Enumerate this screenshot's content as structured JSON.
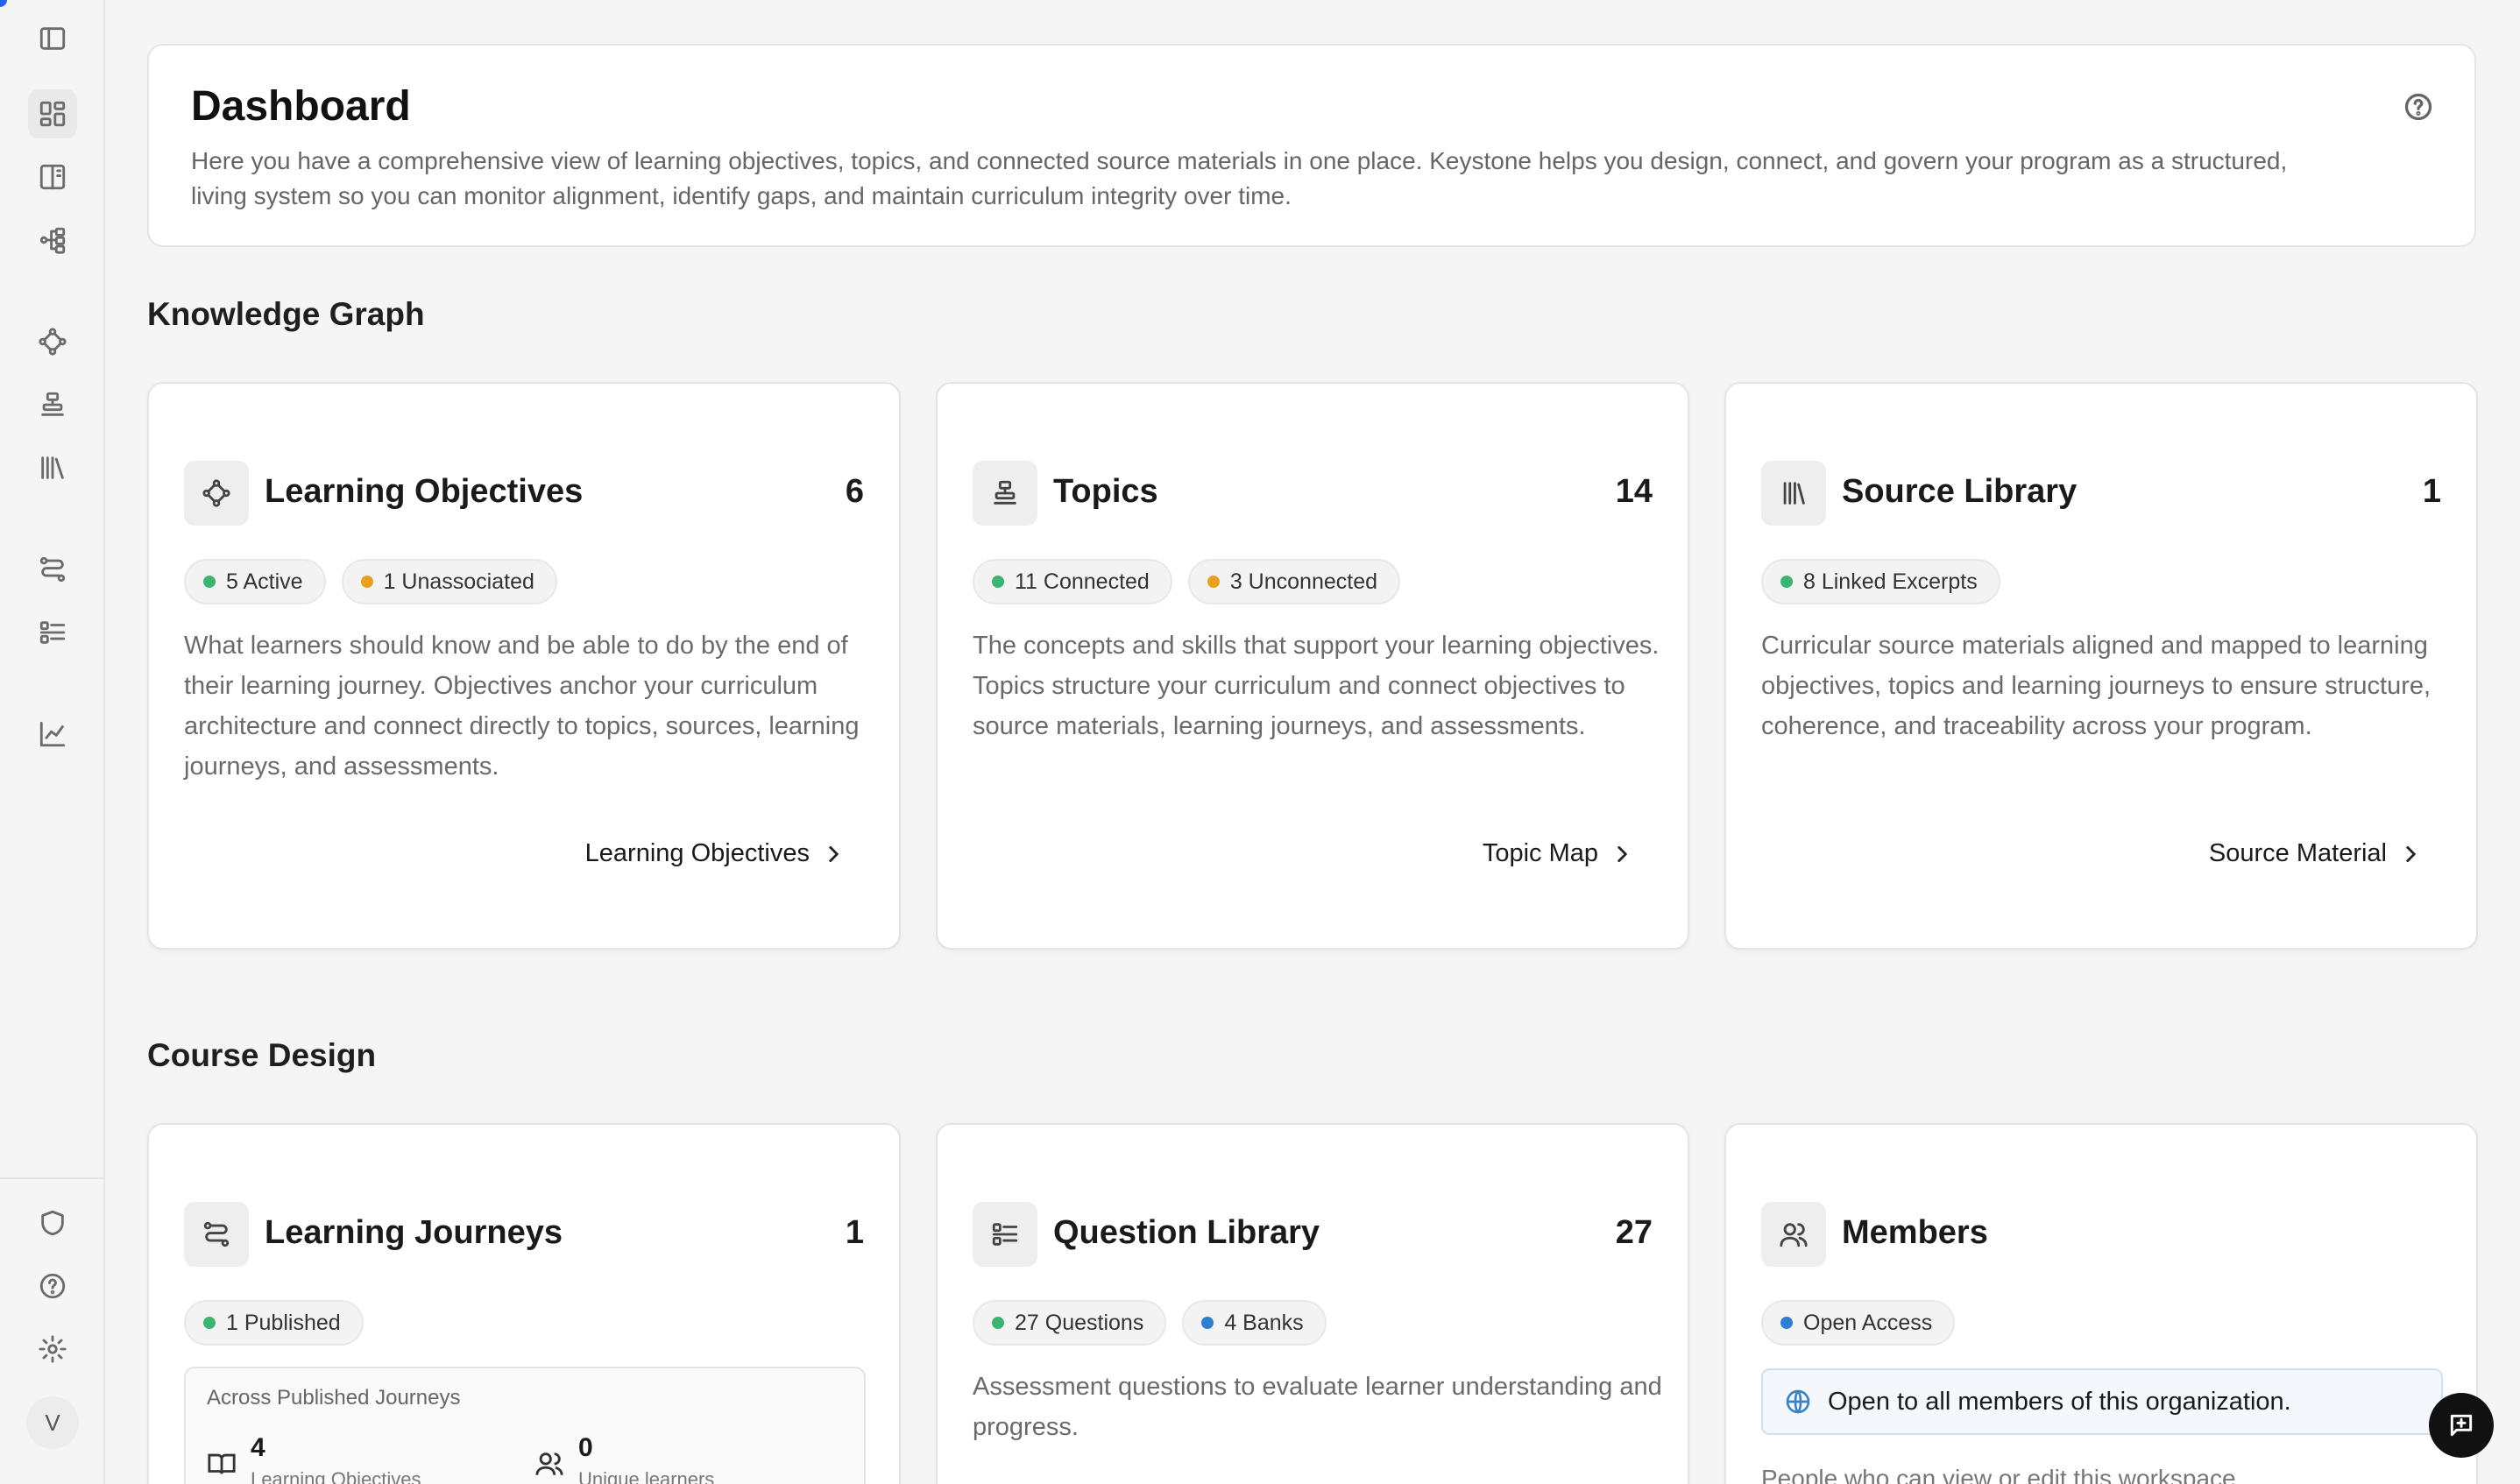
{
  "sidebar": {
    "items": [
      {
        "icon": "panel-toggle-icon"
      },
      {
        "icon": "dashboard-icon"
      },
      {
        "icon": "book-columns-icon"
      },
      {
        "icon": "hierarchy-icon"
      },
      {
        "icon": "objectives-icon"
      },
      {
        "icon": "topics-icon"
      },
      {
        "icon": "library-icon"
      },
      {
        "icon": "journeys-icon"
      },
      {
        "icon": "question-list-icon"
      },
      {
        "icon": "analytics-chart-icon"
      },
      {
        "icon": "shield-icon"
      },
      {
        "icon": "help-circle-icon"
      },
      {
        "icon": "settings-gear-icon"
      }
    ],
    "avatar_initial": "V"
  },
  "header": {
    "title": "Dashboard",
    "description": "Here you have a comprehensive view of learning objectives, topics, and connected source materials in one place. Keystone helps you design, connect, and govern your program as a structured, living system so you can monitor alignment, identify gaps, and maintain curriculum integrity over time."
  },
  "sections": {
    "knowledge_graph": "Knowledge Graph",
    "course_design": "Course Design"
  },
  "colors": {
    "green": "#3cb371",
    "orange": "#e8a020",
    "blue": "#2f7fd0"
  },
  "cards": {
    "learning_objectives": {
      "title": "Learning Objectives",
      "count": "6",
      "badge1": "5 Active",
      "badge2": "1 Unassociated",
      "description": "What learners should know and be able to do by the end of their learning journey. Objectives anchor your curriculum architecture and connect directly to topics, sources, learning journeys, and assessments.",
      "link": "Learning Objectives"
    },
    "topics": {
      "title": "Topics",
      "count": "14",
      "badge1": "11 Connected",
      "badge2": "3 Unconnected",
      "description": "The concepts and skills that support your learning objectives. Topics structure your curriculum and connect objectives to source materials, learning journeys, and assessments.",
      "link": "Topic Map"
    },
    "source_library": {
      "title": "Source Library",
      "count": "1",
      "badge1": "8 Linked Excerpts",
      "description": "Curricular source materials aligned and mapped to learning objectives, topics and learning journeys to ensure structure, coherence, and traceability across your program.",
      "link": "Source Material"
    },
    "learning_journeys": {
      "title": "Learning Journeys",
      "count": "1",
      "badge1": "1 Published",
      "box_label": "Across Published Journeys",
      "metric1_value": "4",
      "metric1_label": "Learning Objectives",
      "metric2_value": "0",
      "metric2_label": "Unique learners"
    },
    "question_library": {
      "title": "Question Library",
      "count": "27",
      "badge1": "27 Questions",
      "badge2": "4 Banks",
      "description": "Assessment questions to evaluate learner understanding and progress."
    },
    "members": {
      "title": "Members",
      "badge1": "Open Access",
      "info": "Open to all members of this organization.",
      "footer": "People who can view or edit this workspace"
    }
  }
}
